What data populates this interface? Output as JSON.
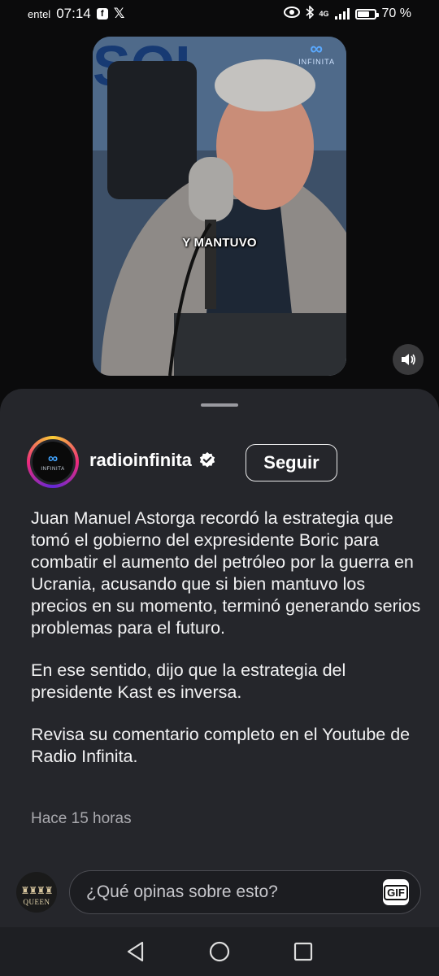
{
  "status_bar": {
    "carrier": "entel",
    "time": "07:14",
    "battery_percent_label": "70 %",
    "battery_level": 0.7,
    "network": "4G",
    "icons": [
      "facebook-icon",
      "x-icon",
      "eye-icon",
      "bluetooth-icon",
      "signal-icon",
      "battery-icon"
    ]
  },
  "video": {
    "caption": "Y MANTUVO",
    "watermark": "INFINITA",
    "sound_icon": "speaker-icon"
  },
  "post": {
    "username": "radioinfinita",
    "avatar_text": "INFINITA",
    "verified": true,
    "follow_label": "Seguir",
    "paragraphs": [
      "Juan Manuel Astorga recordó la estrategia que tomó el gobierno del expresidente Boric para combatir el aumento del petróleo por la guerra en Ucrania, acusando que si bien mantuvo los precios en su momento, terminó generando serios problemas para el futuro.",
      "En ese sentido, dijo que la estrategia del presidente Kast es inversa.",
      "Revisa su comentario completo en el Youtube de Radio Infinita."
    ],
    "time_ago": "Hace 15 horas"
  },
  "comment": {
    "avatar_label": "QUEEN",
    "placeholder": "¿Qué opinas sobre esto?",
    "gif_label": "GIF"
  },
  "navbar": {
    "items": [
      "back",
      "home",
      "recents"
    ]
  },
  "colors": {
    "sheet_bg": "#25262b",
    "page_bg": "#0b0b0c",
    "brand_blue": "#42a5ff"
  }
}
